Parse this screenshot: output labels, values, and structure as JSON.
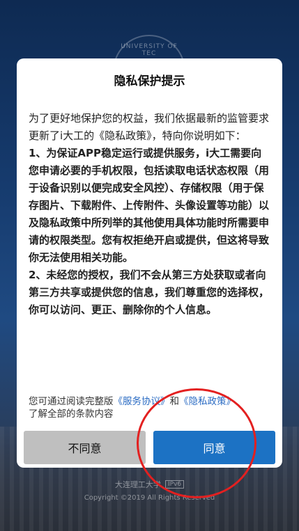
{
  "background": {
    "seal_text": "UNIVERSITY OF TEC",
    "footer_name": "大连理工大学",
    "footer_badge": "IPv6",
    "copyright": "Copyright ©2019 All Rights Reserved"
  },
  "dialog": {
    "title": "隐私保护提示",
    "paragraphs": [
      "为了更好地保护您的权益，我们依据最新的监管要求更新了i大工的《隐私政策》，特向你说明如下：",
      "1、为保证APP稳定运行或提供服务，i大工需要向您申请必要的手机权限，包括读取电话状态权限（用于设备识别以便完成安全风控）、存储权限（用于保存图片、下载附件、上传附件、头像设置等功能）以及隐私政策中所列举的其他使用具体功能时所需要申请的权限类型。您有权拒绝开启或提供，但这将导致你无法使用相关功能。",
      "2、未经您的授权，我们不会从第三方处获取或者向第三方共享或提供您的信息，我们尊重您的选择权，你可以访问、更正、删除你的个人信息。"
    ],
    "tail_prefix": "您可通过阅读完整版",
    "service_link": "《服务协议》",
    "tail_and": "和",
    "privacy_link": "《隐私政策》",
    "tail_suffix": "了解全部的条款内容",
    "disagree_label": "不同意",
    "agree_label": "同意"
  },
  "colors": {
    "agree_button": "#1c72c4",
    "disagree_button": "#bfbfbf",
    "link": "#2a6bc3",
    "annotation": "#e32020"
  }
}
